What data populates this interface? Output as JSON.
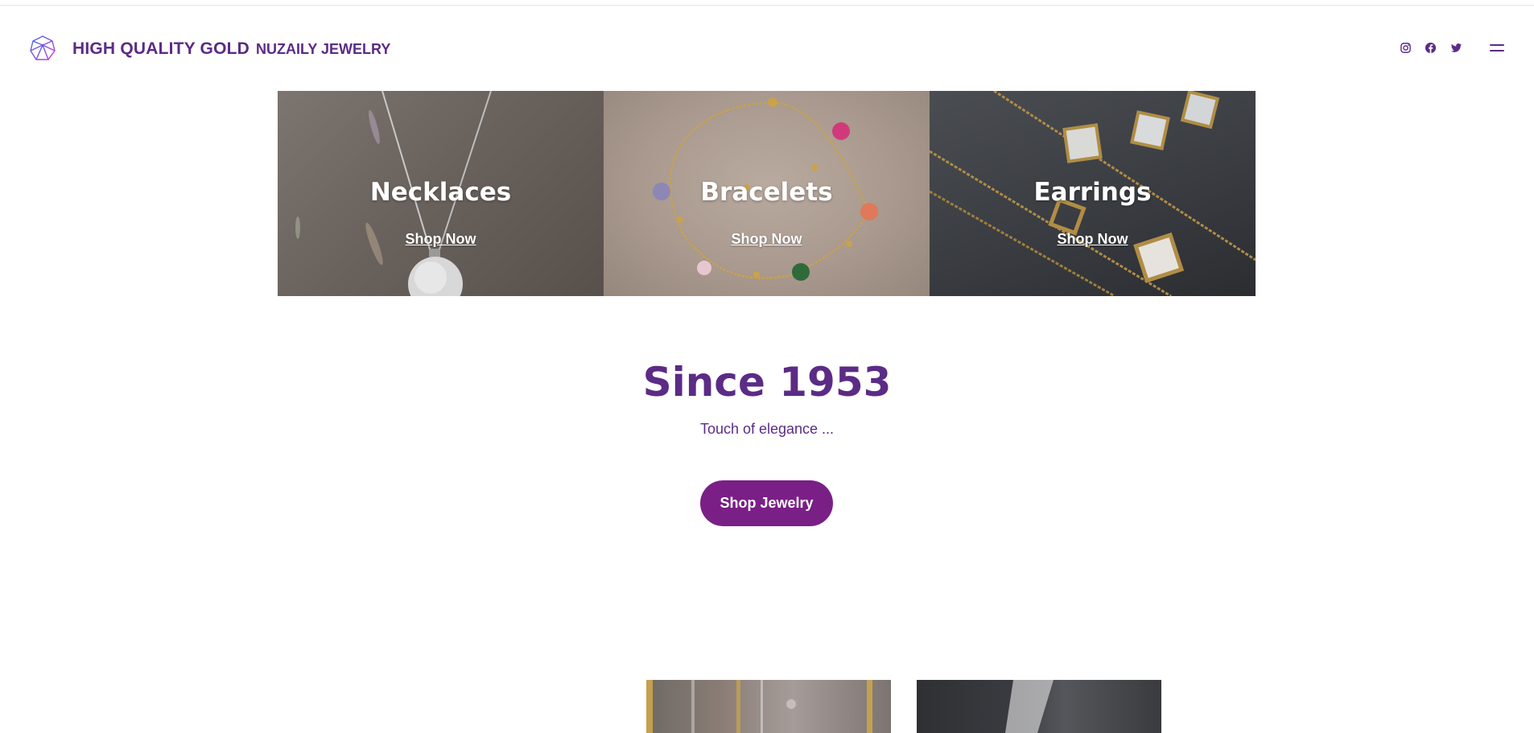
{
  "header": {
    "brand": "HIGH QUALITY GOLD",
    "subbrand": "NUZAILY JEWELRY",
    "logo_icon": "diamond-logo-icon",
    "social": [
      {
        "name": "instagram-icon"
      },
      {
        "name": "facebook-icon"
      },
      {
        "name": "twitter-icon"
      }
    ],
    "menu_icon": "hamburger-menu-icon"
  },
  "categories": [
    {
      "title": "Necklaces",
      "link": "Shop Now"
    },
    {
      "title": "Bracelets",
      "link": "Shop Now"
    },
    {
      "title": "Earrings",
      "link": "Shop Now"
    }
  ],
  "hero": {
    "title": "Since 1953",
    "subtitle": "Touch of elegance ...",
    "button": "Shop Jewelry"
  },
  "colors": {
    "brand_purple": "#5b2b86",
    "button_purple": "#7a1f86",
    "background": "#ffffff"
  }
}
